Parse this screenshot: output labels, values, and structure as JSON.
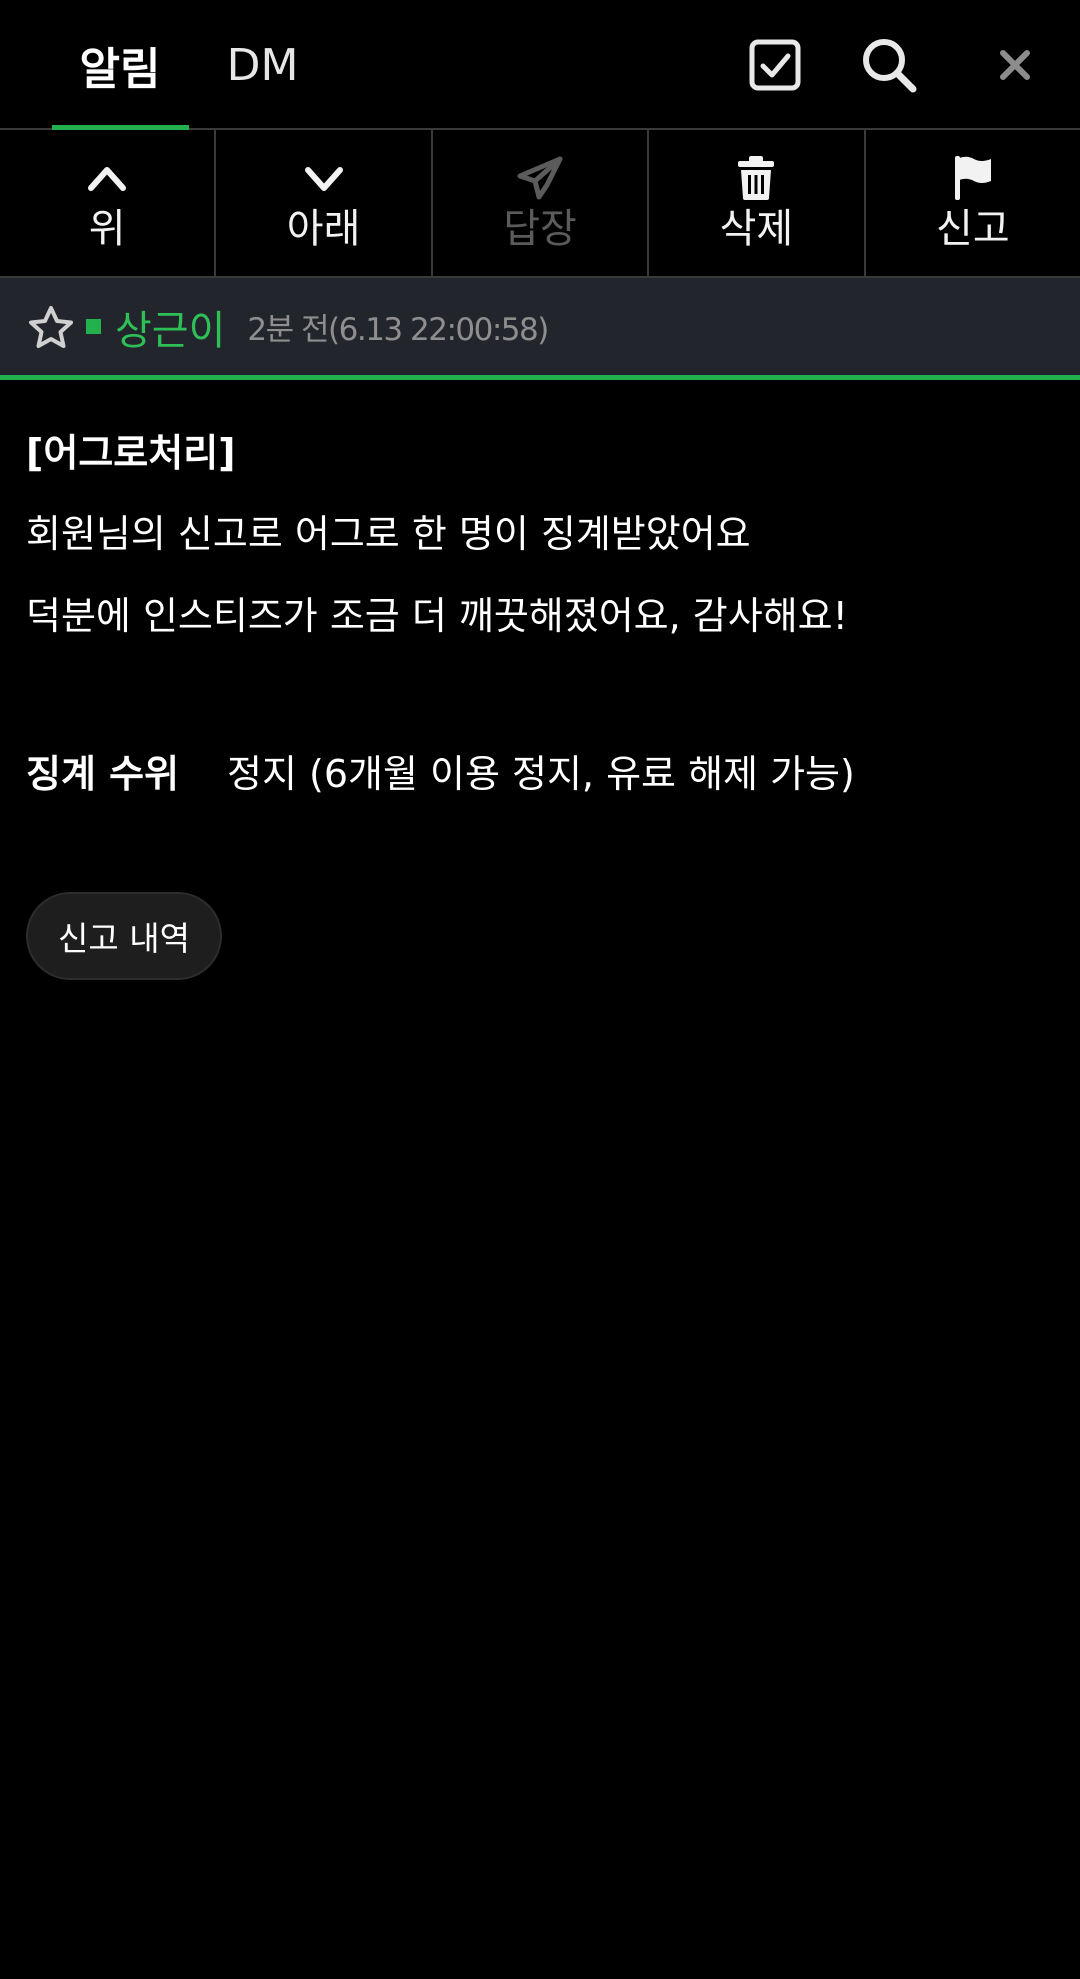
{
  "header": {
    "tabs": [
      {
        "label": "알림",
        "active": true
      },
      {
        "label": "DM",
        "active": false
      }
    ],
    "icons": [
      "check-square-icon",
      "search-icon",
      "close-icon"
    ],
    "accent_color": "#22b14c"
  },
  "toolbar": {
    "buttons": [
      {
        "label": "위",
        "icon": "chevron-up-icon",
        "enabled": true
      },
      {
        "label": "아래",
        "icon": "chevron-down-icon",
        "enabled": true
      },
      {
        "label": "답장",
        "icon": "paper-plane-icon",
        "enabled": false
      },
      {
        "label": "삭제",
        "icon": "trash-icon",
        "enabled": true
      },
      {
        "label": "신고",
        "icon": "flag-icon",
        "enabled": true
      }
    ]
  },
  "sender": {
    "name": "상근이",
    "time": "2분 전(6.13 22:00:58)",
    "starred": false,
    "name_color": "#2fbf57"
  },
  "message": {
    "title": "[어그로처리]",
    "lines": [
      "회원님의 신고로 어그로 한 명이 징계받았어요",
      "덕분에 인스티즈가 조금 더 깨끗해졌어요, 감사해요!"
    ],
    "penalty_label": "징계 수위",
    "penalty_value": "정지 (6개월 이용 정지, 유료 해제 가능)",
    "report_history_button": "신고 내역"
  }
}
